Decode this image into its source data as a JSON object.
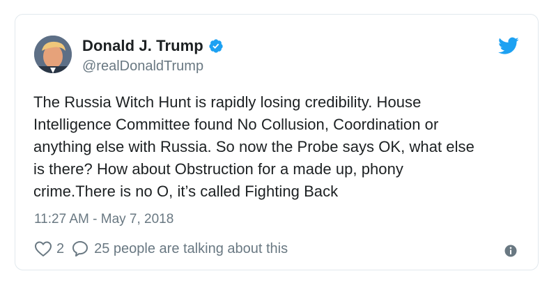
{
  "tweet": {
    "author": {
      "name": "Donald J. Trump",
      "handle": "@realDonaldTrump",
      "verified": true
    },
    "text": "The Russia Witch Hunt is rapidly losing credibility. House\nIntelligence Committee found No Collusion, Coordination or\nanything else with Russia. So now the Probe says OK, what else\nis there? How about Obstruction for a made up, phony\ncrime.There is no O, it’s called Fighting Back",
    "timestamp": "11:27 AM - May 7, 2018",
    "actions": {
      "like_count": "2",
      "reply_text": "25 people are talking about this"
    }
  },
  "icons": {
    "brand": "twitter-bird-icon",
    "verified": "verified-badge-icon",
    "like": "heart-icon",
    "reply": "speech-bubble-icon",
    "info": "info-icon"
  },
  "colors": {
    "brand": "#1da1f2",
    "text": "#1c2022",
    "secondary_text": "#697882",
    "border": "#e1e8ed"
  }
}
